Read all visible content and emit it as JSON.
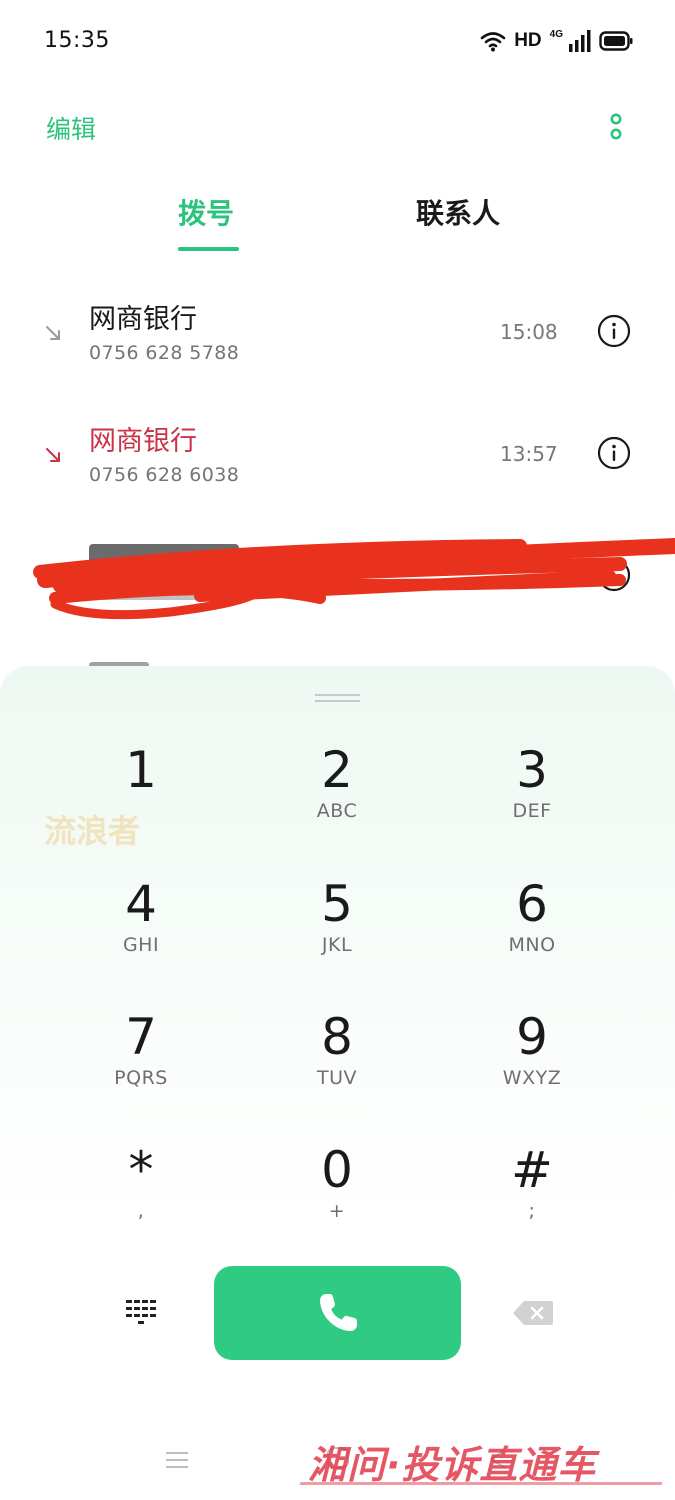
{
  "status_bar": {
    "time": "15:35",
    "hd": "HD",
    "network": "4G",
    "icons": [
      "wifi-icon",
      "signal-icon",
      "battery-icon"
    ]
  },
  "header": {
    "edit_label": "编辑",
    "more_icon": "more-vertical-icon"
  },
  "tabs": [
    {
      "label": "拨号",
      "active": true
    },
    {
      "label": "联系人",
      "active": false
    }
  ],
  "call_log": [
    {
      "name": "网商银行",
      "number": "0756 628 5788",
      "time": "15:08",
      "type": "incoming",
      "icon": "incoming-call-icon"
    },
    {
      "name": "网商银行",
      "number": "0756 628 6038",
      "time": "13:57",
      "type": "missed",
      "icon": "missed-call-icon"
    },
    {
      "name": "",
      "number": "",
      "time": "",
      "type": "redacted",
      "icon": "info-icon"
    }
  ],
  "keypad": {
    "keys": [
      {
        "digit": "1",
        "letters": ""
      },
      {
        "digit": "2",
        "letters": "ABC"
      },
      {
        "digit": "3",
        "letters": "DEF"
      },
      {
        "digit": "4",
        "letters": "GHI"
      },
      {
        "digit": "5",
        "letters": "JKL"
      },
      {
        "digit": "6",
        "letters": "MNO"
      },
      {
        "digit": "7",
        "letters": "PQRS"
      },
      {
        "digit": "8",
        "letters": "TUV"
      },
      {
        "digit": "9",
        "letters": "WXYZ"
      },
      {
        "digit": "*",
        "letters": ","
      },
      {
        "digit": "0",
        "letters": "+"
      },
      {
        "digit": "#",
        "letters": ";"
      }
    ],
    "watermark": "流浪者"
  },
  "actions": {
    "dialpad_icon": "dialpad-icon",
    "call_icon": "phone-icon",
    "backspace_icon": "backspace-icon"
  },
  "colors": {
    "accent": "#2cc47d",
    "call_button": "#2fcb82",
    "missed": "#cc3345",
    "redaction": "#e8321e"
  },
  "footer": {
    "site_watermark": "湘问·投诉直通车"
  }
}
